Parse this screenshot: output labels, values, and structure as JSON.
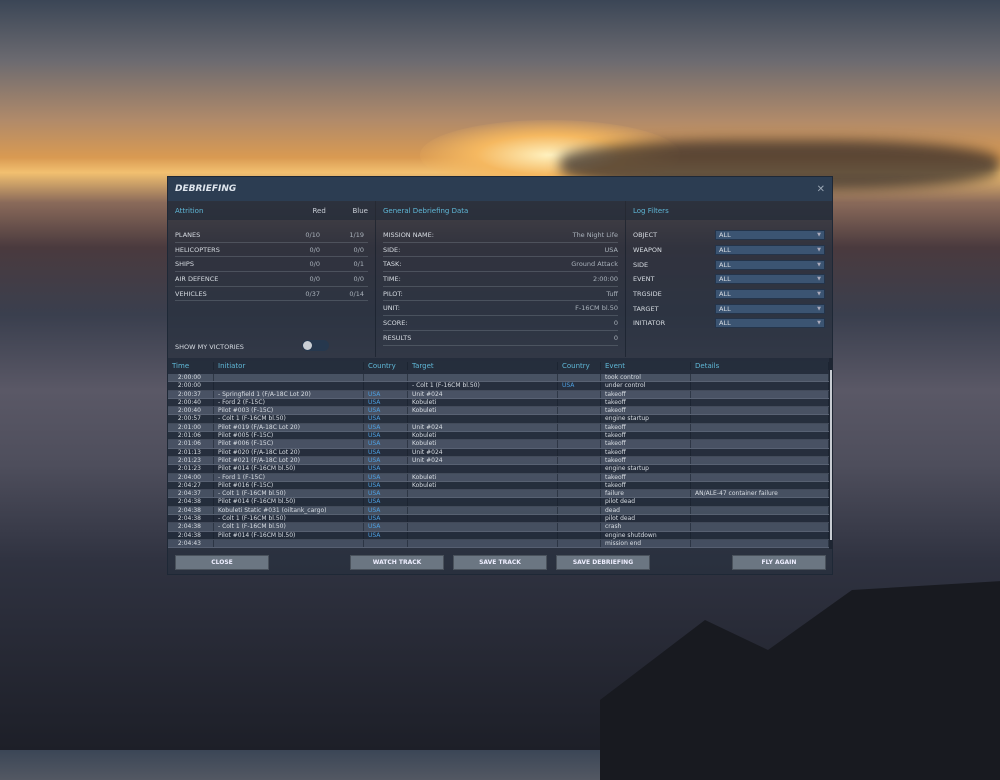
{
  "title": "DEBRIEFING",
  "attrition": {
    "header": "Attrition",
    "red_label": "Red",
    "blue_label": "Blue",
    "rows": [
      {
        "label": "PLANES",
        "red": "0/10",
        "blue": "1/19"
      },
      {
        "label": "HELICOPTERS",
        "red": "0/0",
        "blue": "0/0"
      },
      {
        "label": "SHIPS",
        "red": "0/0",
        "blue": "0/1"
      },
      {
        "label": "AIR DEFENCE",
        "red": "0/0",
        "blue": "0/0"
      },
      {
        "label": "VEHICLES",
        "red": "0/37",
        "blue": "0/14"
      }
    ],
    "show_victories": "SHOW MY VICTORIES",
    "show_victories_on": false
  },
  "general": {
    "header": "General Debriefing Data",
    "rows": [
      {
        "label": "MISSION NAME:",
        "value": "The Night Life"
      },
      {
        "label": "SIDE:",
        "value": "USA"
      },
      {
        "label": "TASK:",
        "value": "Ground Attack"
      },
      {
        "label": "TIME:",
        "value": "2:00:00"
      },
      {
        "label": "PILOT:",
        "value": "Tuff"
      },
      {
        "label": "UNIT:",
        "value": "F-16CM bl.50"
      },
      {
        "label": "SCORE:",
        "value": "0"
      },
      {
        "label": "RESULTS",
        "value": "0"
      }
    ]
  },
  "filters": {
    "header": "Log Filters",
    "rows": [
      {
        "label": "OBJECT",
        "value": "ALL"
      },
      {
        "label": "WEAPON",
        "value": "ALL"
      },
      {
        "label": "SIDE",
        "value": "ALL"
      },
      {
        "label": "EVENT",
        "value": "ALL"
      },
      {
        "label": "TRGSIDE",
        "value": "ALL"
      },
      {
        "label": "TARGET",
        "value": "ALL"
      },
      {
        "label": "INITIATOR",
        "value": "ALL"
      }
    ]
  },
  "log": {
    "columns": [
      "Time",
      "Initiator",
      "Country",
      "Target",
      "Country",
      "Event",
      "Details"
    ],
    "rows": [
      [
        "2:00:00",
        "",
        "",
        "",
        "",
        "took control",
        ""
      ],
      [
        "2:00:00",
        "",
        "",
        "- Colt 1 (F-16CM bl.50)",
        "USA",
        "under control",
        ""
      ],
      [
        "2:00:37",
        "- Springfield 1 (F/A-18C Lot 20)",
        "USA",
        "Unit #024",
        "",
        "takeoff",
        ""
      ],
      [
        "2:00:40",
        "- Ford 2 (F-15C)",
        "USA",
        "Kobuleti",
        "",
        "takeoff",
        ""
      ],
      [
        "2:00:40",
        "Pilot #003 (F-15C)",
        "USA",
        "Kobuleti",
        "",
        "takeoff",
        ""
      ],
      [
        "2:00:57",
        "- Colt 1 (F-16CM bl.50)",
        "USA",
        "",
        "",
        "engine startup",
        ""
      ],
      [
        "2:01:00",
        "Pilot #019 (F/A-18C Lot 20)",
        "USA",
        "Unit #024",
        "",
        "takeoff",
        ""
      ],
      [
        "2:01:06",
        "Pilot #005 (F-15C)",
        "USA",
        "Kobuleti",
        "",
        "takeoff",
        ""
      ],
      [
        "2:01:06",
        "Pilot #006 (F-15C)",
        "USA",
        "Kobuleti",
        "",
        "takeoff",
        ""
      ],
      [
        "2:01:13",
        "Pilot #020 (F/A-18C Lot 20)",
        "USA",
        "Unit #024",
        "",
        "takeoff",
        ""
      ],
      [
        "2:01:23",
        "Pilot #021 (F/A-18C Lot 20)",
        "USA",
        "Unit #024",
        "",
        "takeoff",
        ""
      ],
      [
        "2:01:23",
        "Pilot #014 (F-16CM bl.50)",
        "USA",
        "",
        "",
        "engine startup",
        ""
      ],
      [
        "2:04:00",
        "- Ford 1 (F-15C)",
        "USA",
        "Kobuleti",
        "",
        "takeoff",
        ""
      ],
      [
        "2:04:27",
        "Pilot #016 (F-15C)",
        "USA",
        "Kobuleti",
        "",
        "takeoff",
        ""
      ],
      [
        "2:04:37",
        "- Colt 1 (F-16CM bl.50)",
        "USA",
        "",
        "",
        "failure",
        "AN/ALE-47 container failure"
      ],
      [
        "2:04:38",
        "Pilot #014 (F-16CM bl.50)",
        "USA",
        "",
        "",
        "pilot dead",
        ""
      ],
      [
        "2:04:38",
        "Kobuleti Static #031 (oiltank_cargo)",
        "USA",
        "",
        "",
        "dead",
        ""
      ],
      [
        "2:04:38",
        "- Colt 1 (F-16CM bl.50)",
        "USA",
        "",
        "",
        "pilot dead",
        ""
      ],
      [
        "2:04:38",
        "- Colt 1 (F-16CM bl.50)",
        "USA",
        "",
        "",
        "crash",
        ""
      ],
      [
        "2:04:38",
        "Pilot #014 (F-16CM bl.50)",
        "USA",
        "",
        "",
        "engine shutdown",
        ""
      ],
      [
        "2:04:43",
        "",
        "",
        "",
        "",
        "mission end",
        ""
      ]
    ]
  },
  "buttons": {
    "close": "CLOSE",
    "watch": "WATCH TRACK",
    "save_track": "SAVE TRACK",
    "save_debrief": "SAVE DEBRIEFING",
    "fly_again": "FLY AGAIN"
  }
}
